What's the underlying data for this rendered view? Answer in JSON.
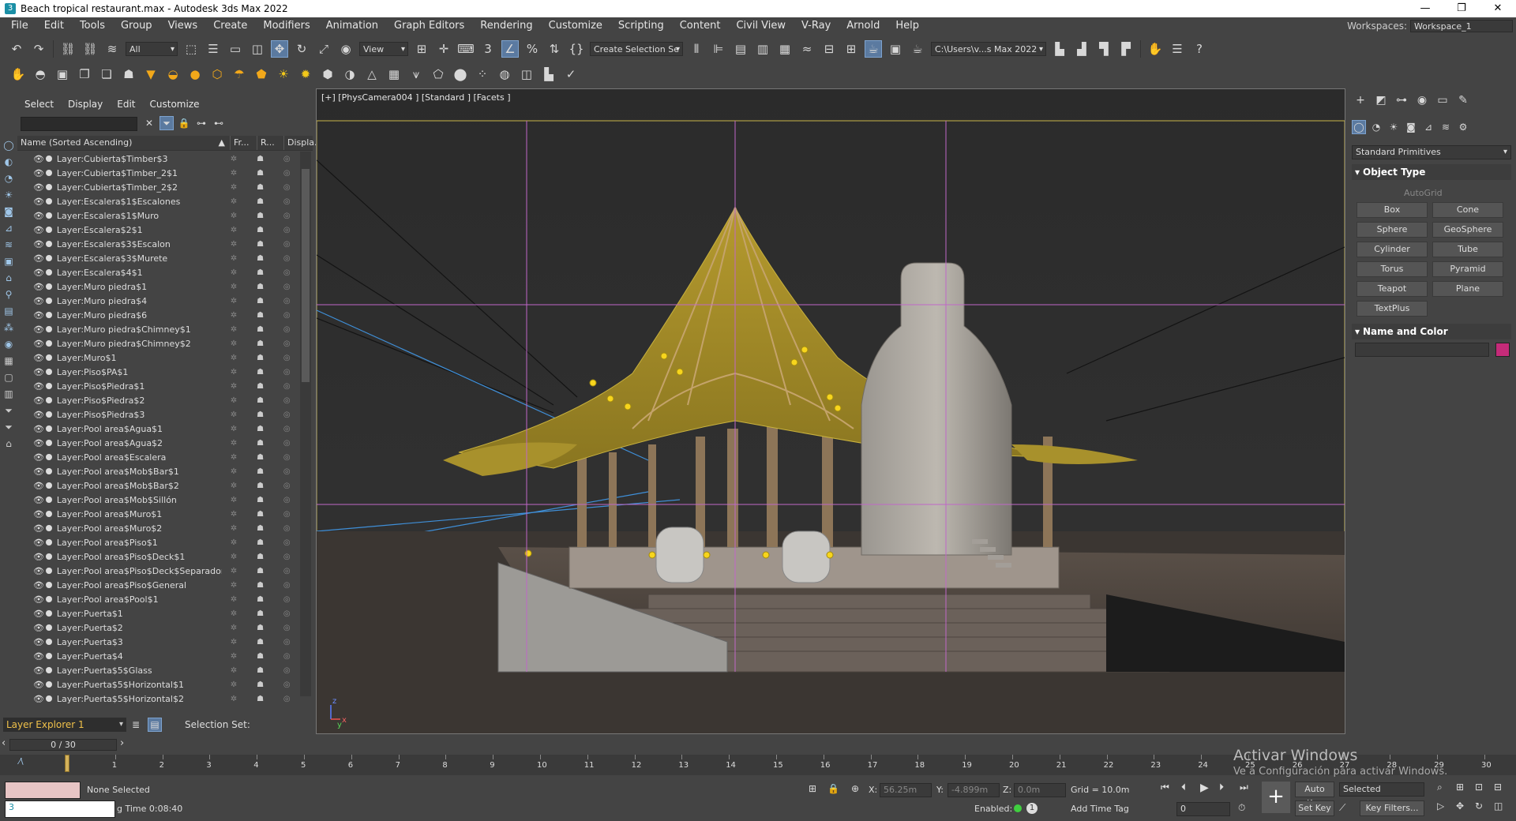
{
  "window": {
    "title": "Beach tropical restaurant.max - Autodesk 3ds Max 2022",
    "app_icon": "3"
  },
  "menu": [
    "File",
    "Edit",
    "Tools",
    "Group",
    "Views",
    "Create",
    "Modifiers",
    "Animation",
    "Graph Editors",
    "Rendering",
    "Customize",
    "Scripting",
    "Content",
    "Civil View",
    "V-Ray",
    "Arnold",
    "Help"
  ],
  "workspaces": {
    "label": "Workspaces:",
    "value": "Workspace_1"
  },
  "main_toolbar": {
    "filter": "All",
    "coord": "View",
    "selection_set": "Create Selection Se",
    "project_path": "C:\\Users\\v...s Max 2022"
  },
  "explorer": {
    "menu": [
      "Select",
      "Display",
      "Edit",
      "Customize"
    ],
    "columns": {
      "name": "Name (Sorted Ascending)",
      "frozen": "Fr...",
      "renderable": "R...",
      "display": "Displa..."
    },
    "rows": [
      "Layer:Cubierta$Timber$3",
      "Layer:Cubierta$Timber_2$1",
      "Layer:Cubierta$Timber_2$2",
      "Layer:Escalera$1$Escalones",
      "Layer:Escalera$1$Muro",
      "Layer:Escalera$2$1",
      "Layer:Escalera$3$Escalon",
      "Layer:Escalera$3$Murete",
      "Layer:Escalera$4$1",
      "Layer:Muro piedra$1",
      "Layer:Muro piedra$4",
      "Layer:Muro piedra$6",
      "Layer:Muro piedra$Chimney$1",
      "Layer:Muro piedra$Chimney$2",
      "Layer:Muro$1",
      "Layer:Piso$PA$1",
      "Layer:Piso$Piedra$1",
      "Layer:Piso$Piedra$2",
      "Layer:Piso$Piedra$3",
      "Layer:Pool area$Agua$1",
      "Layer:Pool area$Agua$2",
      "Layer:Pool area$Escalera",
      "Layer:Pool area$Mob$Bar$1",
      "Layer:Pool area$Mob$Bar$2",
      "Layer:Pool area$Mob$Sillón",
      "Layer:Pool area$Muro$1",
      "Layer:Pool area$Muro$2",
      "Layer:Pool area$Piso$1",
      "Layer:Pool area$Piso$Deck$1",
      "Layer:Pool area$Piso$Deck$Separador",
      "Layer:Pool area$Piso$General",
      "Layer:Pool area$Pool$1",
      "Layer:Puerta$1",
      "Layer:Puerta$2",
      "Layer:Puerta$3",
      "Layer:Puerta$4",
      "Layer:Puerta$5$Glass",
      "Layer:Puerta$5$Horizontal$1",
      "Layer:Puerta$5$Horizontal$2"
    ],
    "layer_explorer": "Layer Explorer 1",
    "selection_set_label": "Selection Set:"
  },
  "viewport": {
    "label": "[+] [PhysCamera004 ] [Standard ] [Facets ]",
    "axis_x": "x",
    "axis_y": "y",
    "axis_z": "z"
  },
  "command_panel": {
    "category": "Standard Primitives",
    "object_type_title": "Object Type",
    "autogrid": "AutoGrid",
    "buttons": [
      "Box",
      "Cone",
      "Sphere",
      "GeoSphere",
      "Cylinder",
      "Tube",
      "Torus",
      "Pyramid",
      "Teapot",
      "Plane",
      "TextPlus"
    ],
    "name_color_title": "Name and Color",
    "object_color": "#c52b79"
  },
  "time": {
    "slider": "0 / 30",
    "ticks": [
      "0",
      "1",
      "2",
      "3",
      "4",
      "5",
      "6",
      "7",
      "8",
      "9",
      "10",
      "11",
      "12",
      "13",
      "14",
      "15",
      "16",
      "17",
      "18",
      "19",
      "20",
      "21",
      "22",
      "23",
      "24",
      "25",
      "26",
      "27",
      "28",
      "29",
      "30"
    ]
  },
  "watermark": {
    "line1": "Activar Windows",
    "line2": "Ve a Configuración para activar Windows."
  },
  "status": {
    "selection": "None Selected",
    "render_time": "g Time  0:08:40",
    "x_label": "X:",
    "x_value": "56.25m",
    "y_label": "Y:",
    "y_value": "-4.899m",
    "z_label": "Z:",
    "z_value": "0.0m",
    "grid": "Grid = 10.0m",
    "enabled": "Enabled:",
    "add_time_tag": "Add Time Tag",
    "auto_key": "Auto Key",
    "set_key": "Set Key",
    "key_mode": "Selected",
    "key_filters": "Key Filters...",
    "frame": "0"
  }
}
